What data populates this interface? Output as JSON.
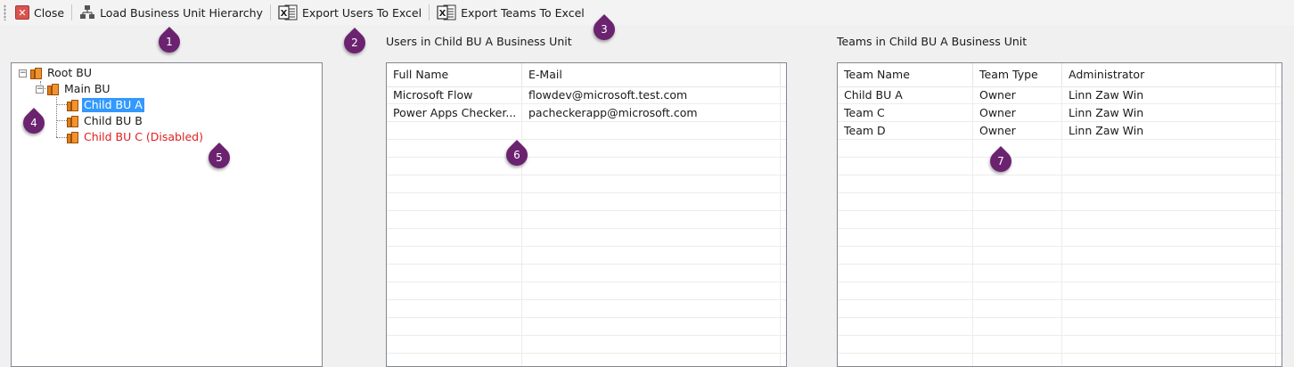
{
  "toolbar": {
    "close_label": "Close",
    "load_label": "Load Business Unit Hierarchy",
    "export_users_label": "Export Users To Excel",
    "export_teams_label": "Export Teams To Excel"
  },
  "tree": {
    "root": "Root BU",
    "main": "Main BU",
    "child_a": "Child BU A",
    "child_b": "Child BU B",
    "child_c": "Child BU C (Disabled)"
  },
  "users": {
    "title": "Users in Child BU A Business Unit",
    "columns": [
      "Full Name",
      "E-Mail"
    ],
    "rows": [
      [
        "Microsoft Flow",
        "flowdev@microsoft.test.com"
      ],
      [
        "Power Apps Checker...",
        "pacheckerapp@microsoft.com"
      ]
    ]
  },
  "teams": {
    "title": "Teams in Child BU A Business Unit",
    "columns": [
      "Team Name",
      "Team Type",
      "Administrator"
    ],
    "rows": [
      [
        "Child BU A",
        "Owner",
        "Linn Zaw Win"
      ],
      [
        "Team C",
        "Owner",
        "Linn Zaw Win"
      ],
      [
        "Team D",
        "Owner",
        "Linn Zaw Win"
      ]
    ]
  },
  "callouts": [
    "1",
    "2",
    "3",
    "4",
    "5",
    "6",
    "7"
  ],
  "colors": {
    "selection": "#3399ff",
    "disabled_text": "#e02020",
    "callout": "#6b2370"
  }
}
